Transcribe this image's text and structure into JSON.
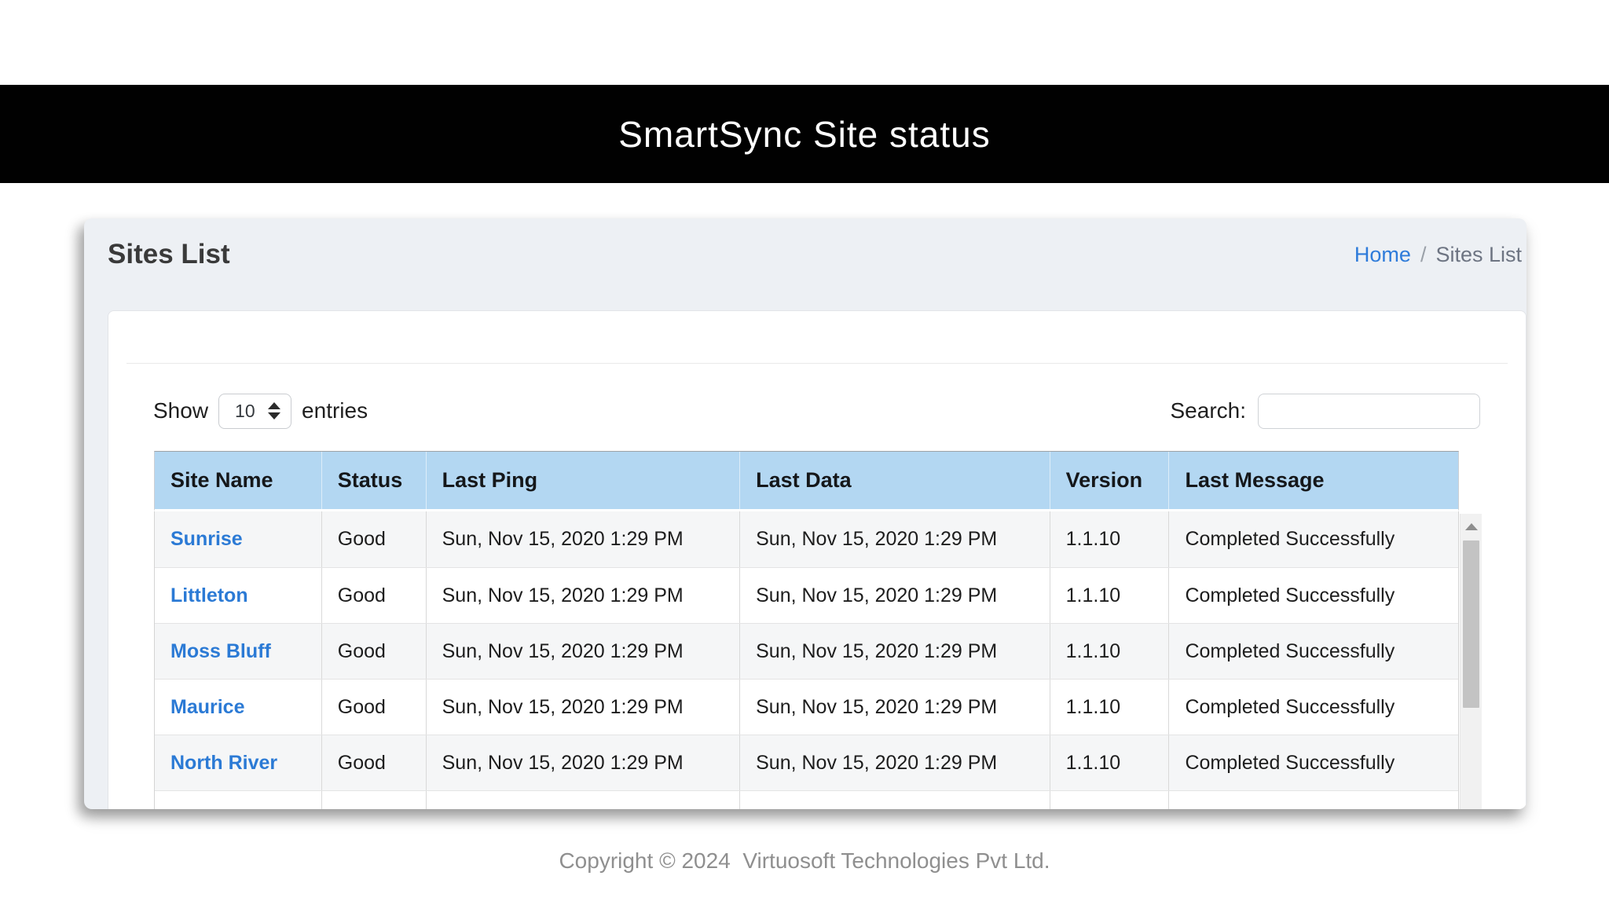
{
  "topbar": {
    "title": "SmartSync Site status"
  },
  "page": {
    "title": "Sites List"
  },
  "breadcrumb": {
    "home": "Home",
    "separator": "/",
    "current": "Sites List"
  },
  "controls": {
    "show_label": "Show",
    "entries_value": "10",
    "entries_label": "entries",
    "search_label": "Search:",
    "search_value": ""
  },
  "table": {
    "columns": [
      "Site Name",
      "Status",
      "Last Ping",
      "Last Data",
      "Version",
      "Last Message"
    ],
    "rows": [
      {
        "site_name": "Sunrise",
        "status": "Good",
        "last_ping": "Sun, Nov 15, 2020 1:29 PM",
        "last_data": "Sun, Nov 15, 2020 1:29 PM",
        "version": "1.1.10",
        "last_message": "Completed Successfully"
      },
      {
        "site_name": "Littleton",
        "status": "Good",
        "last_ping": "Sun, Nov 15, 2020 1:29 PM",
        "last_data": "Sun, Nov 15, 2020 1:29 PM",
        "version": "1.1.10",
        "last_message": "Completed Successfully"
      },
      {
        "site_name": "Moss Bluff",
        "status": "Good",
        "last_ping": "Sun, Nov 15, 2020 1:29 PM",
        "last_data": "Sun, Nov 15, 2020 1:29 PM",
        "version": "1.1.10",
        "last_message": "Completed Successfully"
      },
      {
        "site_name": "Maurice",
        "status": "Good",
        "last_ping": "Sun, Nov 15, 2020 1:29 PM",
        "last_data": "Sun, Nov 15, 2020 1:29 PM",
        "version": "1.1.10",
        "last_message": "Completed Successfully"
      },
      {
        "site_name": "North River",
        "status": "Good",
        "last_ping": "Sun, Nov 15, 2020 1:29 PM",
        "last_data": "Sun, Nov 15, 2020 1:29 PM",
        "version": "1.1.10",
        "last_message": "Completed Successfully"
      }
    ]
  },
  "footer": {
    "text": "Copyright © 2024  Virtuosoft Technologies Pvt Ltd."
  },
  "colors": {
    "topbar_bg": "#010101",
    "table_header_bg": "#b3d7f2",
    "link_blue": "#2b7ad5",
    "breadcrumb_home": "#2e7bda",
    "container_bg": "#edf0f4"
  }
}
